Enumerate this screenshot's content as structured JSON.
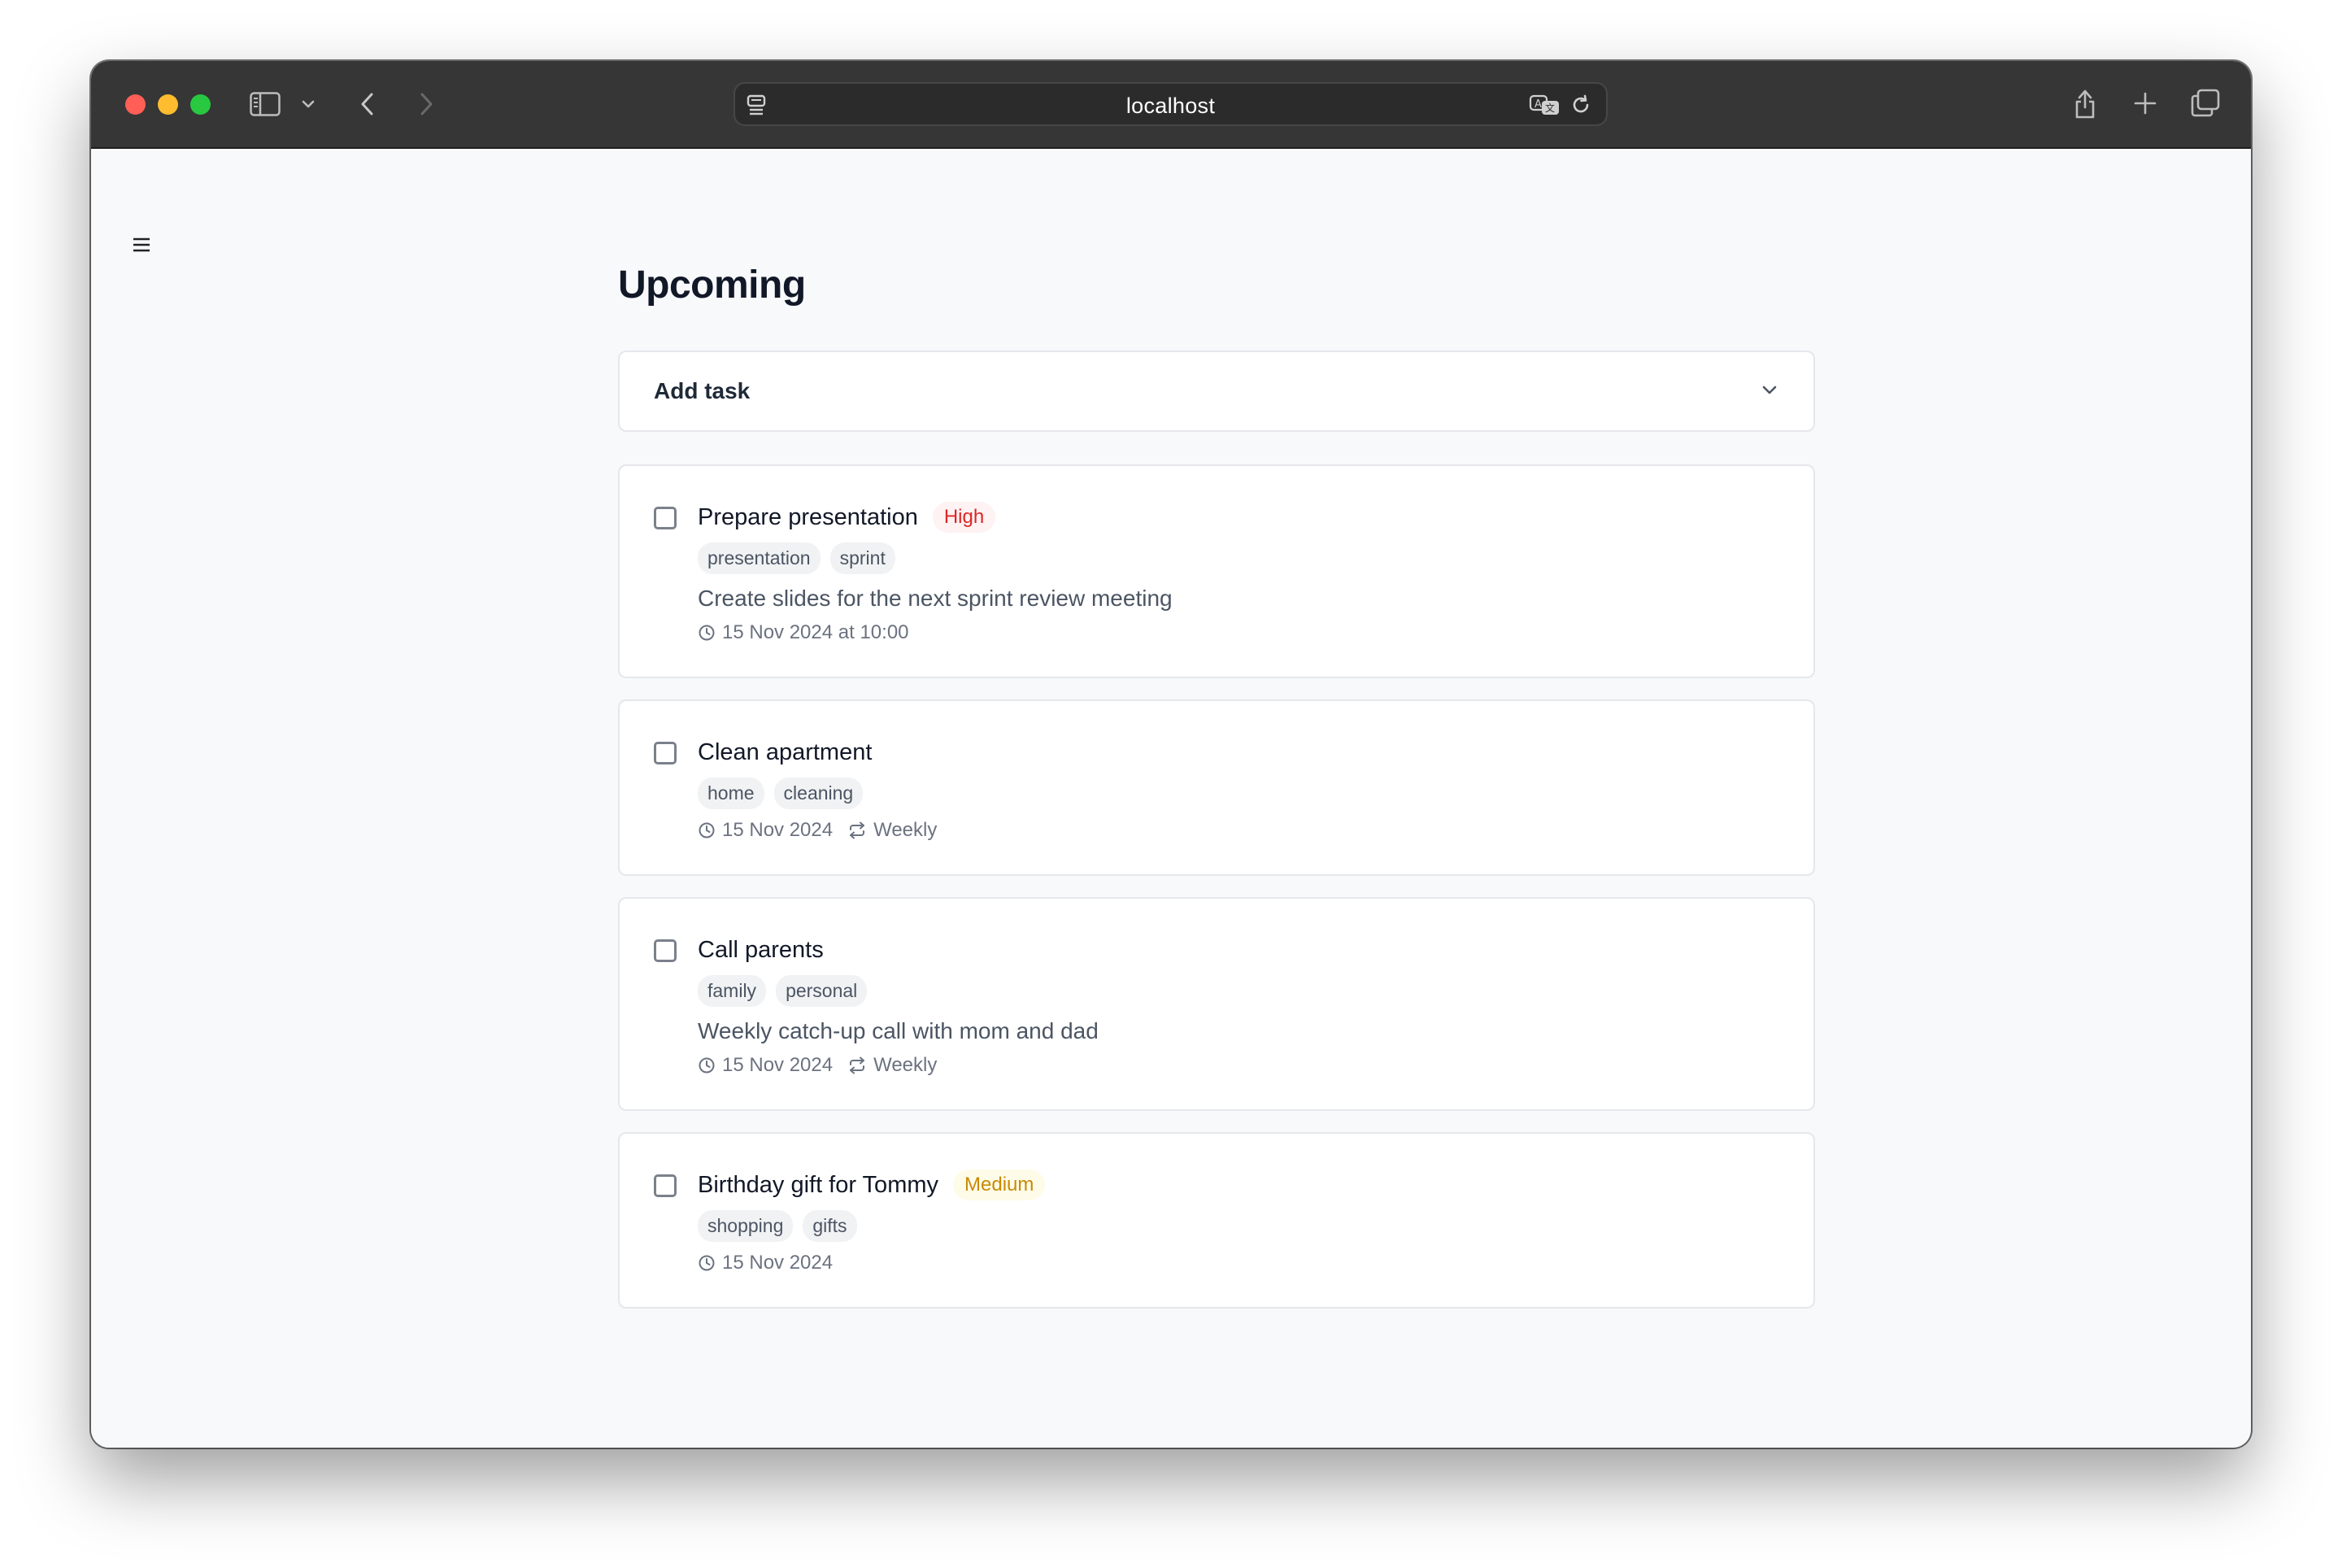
{
  "browser": {
    "url": "localhost",
    "colors": {
      "close": "#ff5f57",
      "minimize": "#febc2e",
      "zoom": "#28c840"
    },
    "icons": [
      "sidebar-icon",
      "chevron-down-icon",
      "back-icon",
      "forward-icon",
      "page-menu-icon",
      "translate-icon",
      "reload-icon",
      "share-icon",
      "new-tab-icon",
      "tabs-overview-icon"
    ]
  },
  "page": {
    "title": "Upcoming",
    "add_task": {
      "label": "Add task"
    }
  },
  "tasks": [
    {
      "title": "Prepare presentation",
      "priority": "High",
      "priority_color": "#dc2626",
      "priority_bg": "#fef2f2",
      "tags": [
        "presentation",
        "sprint"
      ],
      "description": "Create slides for the next sprint review meeting",
      "due": "15 Nov 2024 at 10:00",
      "repeat": ""
    },
    {
      "title": "Clean apartment",
      "priority": "",
      "tags": [
        "home",
        "cleaning"
      ],
      "description": "",
      "due": "15 Nov 2024",
      "repeat": "Weekly"
    },
    {
      "title": "Call parents",
      "priority": "",
      "tags": [
        "family",
        "personal"
      ],
      "description": "Weekly catch-up call with mom and dad",
      "due": "15 Nov 2024",
      "repeat": "Weekly"
    },
    {
      "title": "Birthday gift for Tommy",
      "priority": "Medium",
      "priority_color": "#ca8a04",
      "priority_bg": "#fefce8",
      "tags": [
        "shopping",
        "gifts"
      ],
      "description": "",
      "due": "15 Nov 2024",
      "repeat": ""
    }
  ]
}
